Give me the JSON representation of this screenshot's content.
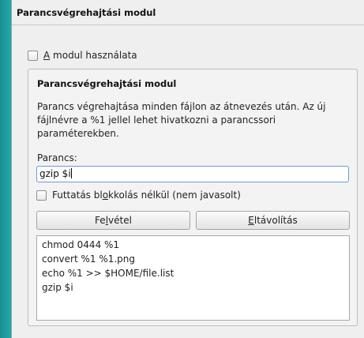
{
  "window": {
    "title": "Parancsvégrehajtási modul"
  },
  "module_checkbox": {
    "mnemonic": "A",
    "label_rest": " modul használata",
    "checked": false
  },
  "group": {
    "title": "Parancsvégrehajtási modul",
    "description": "Parancs végrehajtása minden fájlon az átnevezés után. Az új fájlnévre a %1 jellel lehet hivatkozni a parancssori paraméterekben.",
    "command_label": "Parancs:",
    "command_value": "gzip $i",
    "nonblocking_checkbox": {
      "label_before": "Futtatás bl",
      "mnemonic": "o",
      "label_after": "kkolás nélkül (nem javasolt)",
      "checked": false
    },
    "add_button": {
      "before": "Fe",
      "mnemonic": "l",
      "after": "vétel"
    },
    "remove_button": {
      "before": "",
      "mnemonic": "E",
      "after": "ltávolítás"
    },
    "commands": [
      "chmod 0444 %1",
      "convert %1 %1.png",
      "echo %1 >> $HOME/file.list",
      "gzip $i"
    ]
  }
}
